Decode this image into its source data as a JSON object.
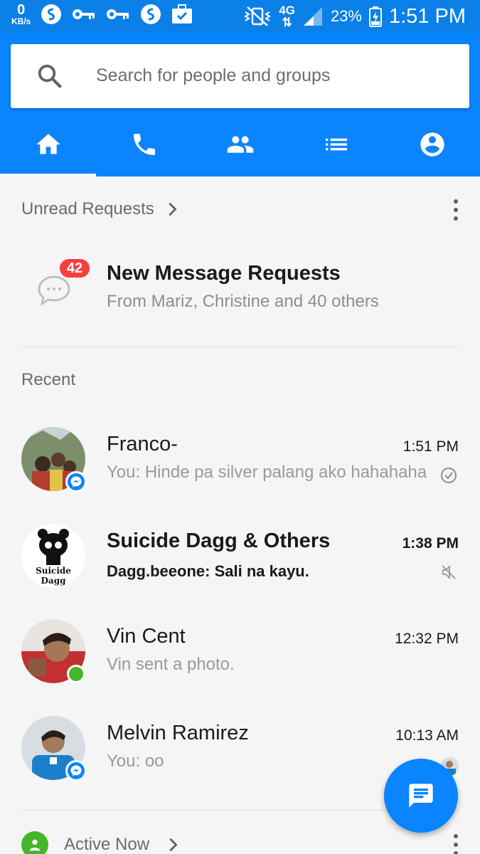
{
  "status_bar": {
    "net_speed": "0",
    "net_speed_unit": "KB/s",
    "network_type": "4G",
    "battery_percent": "23%",
    "time": "1:51 PM",
    "left_icons": [
      "s-icon",
      "key-icon",
      "key-icon",
      "s-icon",
      "briefcase-icon"
    ],
    "right_icons": [
      "vibrate-icon",
      "signal-icon",
      "battery-charging-icon"
    ]
  },
  "search": {
    "placeholder": "Search for people and groups"
  },
  "tabs": [
    {
      "icon": "home-icon",
      "active": true
    },
    {
      "icon": "phone-icon",
      "active": false
    },
    {
      "icon": "groups-icon",
      "active": false
    },
    {
      "icon": "list-icon",
      "active": false
    },
    {
      "icon": "profile-icon",
      "active": false
    }
  ],
  "unread_requests": {
    "header": "Unread Requests",
    "badge_count": "42",
    "title": "New Message Requests",
    "subtitle": "From Mariz, Christine and 40 others"
  },
  "recent": {
    "header": "Recent",
    "conversations": [
      {
        "name": "Franco-",
        "time": "1:51 PM",
        "message": "You: Hinde pa silver palang ako hahahaha",
        "unread": false,
        "status": "sent-check-icon"
      },
      {
        "name": "Suicide Dagg & Others",
        "time": "1:38 PM",
        "message": "Dagg.beeone: Sali na kayu.",
        "unread": true,
        "status": "muted-icon",
        "avatar_text": "Suicide Dagg"
      },
      {
        "name": "Vin Cent",
        "time": "12:32 PM",
        "message": "Vin sent a photo.",
        "unread": false,
        "status": "online"
      },
      {
        "name": "Melvin Ramirez",
        "time": "10:13 AM",
        "message": "You: oo",
        "unread": false,
        "status": "seen-avatar"
      }
    ]
  },
  "active_now": {
    "header": "Active Now"
  },
  "colors": {
    "brand_blue": "#0a84ff",
    "badge_red": "#fa3e3e",
    "online_green": "#44b62a"
  }
}
